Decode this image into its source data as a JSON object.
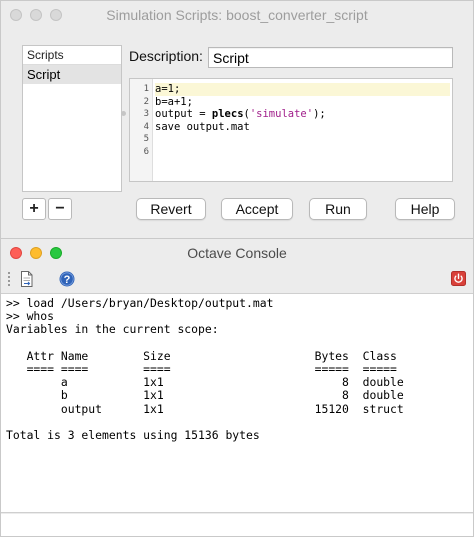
{
  "script_window": {
    "title": "Simulation Scripts: boost_converter_script",
    "list_header": "Scripts",
    "list_items": [
      "Script"
    ],
    "description_label": "Description:",
    "description_value": "Script",
    "line_numbers": [
      "1",
      "2",
      "3",
      "4",
      "5",
      "6"
    ],
    "code": {
      "line1": "a=1;",
      "line2": "b=a+1;",
      "line3_pre": "output = ",
      "line3_kw": "plecs",
      "line3_paren": "(",
      "line3_str": "'simulate'",
      "line3_post": ");",
      "line4": "save output.mat"
    },
    "add_label": "+",
    "remove_label": "−",
    "buttons": {
      "revert": "Revert",
      "accept": "Accept",
      "run": "Run",
      "help": "Help"
    }
  },
  "console_window": {
    "title": "Octave Console",
    "toolbar_icons": [
      "document-icon",
      "help-icon",
      "power-icon"
    ],
    "help_glyph": "?",
    "lines": [
      ">> load /Users/bryan/Desktop/output.mat",
      ">> whos",
      "Variables in the current scope:",
      "",
      "   Attr Name        Size                     Bytes  Class",
      "   ==== ====        ====                     =====  =====",
      "        a           1x1                          8  double",
      "        b           1x1                          8  double",
      "        output      1x1                      15120  struct",
      "",
      "Total is 3 elements using 15136 bytes"
    ]
  },
  "colors": {
    "close": "#fe5f57",
    "minimize": "#febc2e",
    "zoom": "#28c840",
    "inactive_light": "#d9d9d9",
    "string": "#a01d8a",
    "help_blue": "#2f63b8",
    "power_red": "#d9413a"
  }
}
